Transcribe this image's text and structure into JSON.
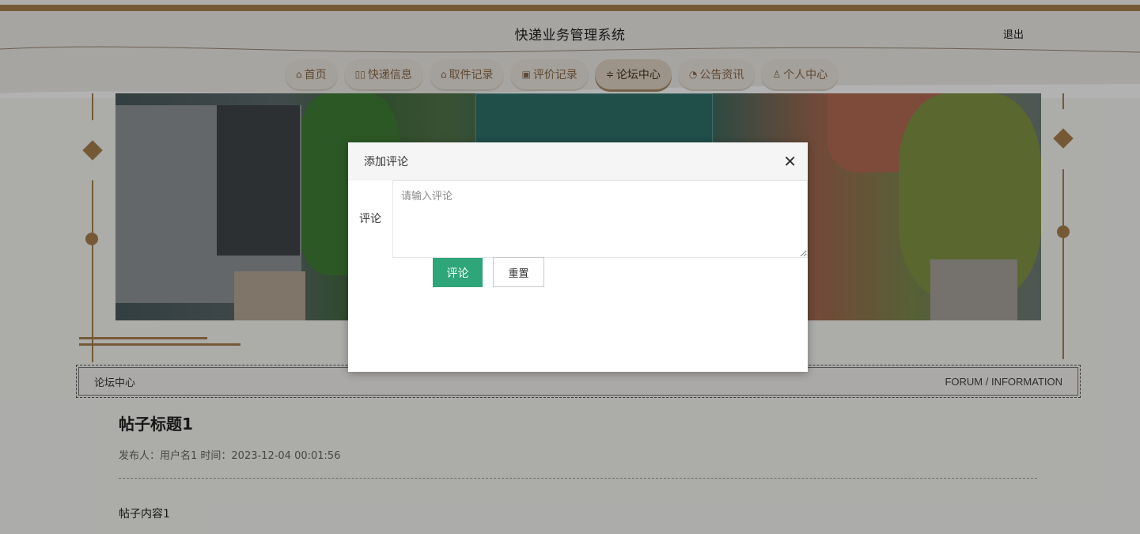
{
  "header": {
    "title": "快递业务管理系统",
    "logout_label": "退出"
  },
  "nav": {
    "items": [
      {
        "label": "首页",
        "icon": "home-icon",
        "glyph": "⌂"
      },
      {
        "label": "快递信息",
        "icon": "book-icon",
        "glyph": "▯▯"
      },
      {
        "label": "取件记录",
        "icon": "package-icon",
        "glyph": "⌂"
      },
      {
        "label": "评价记录",
        "icon": "gift-icon",
        "glyph": "▣"
      },
      {
        "label": "论坛中心",
        "icon": "sliders-icon",
        "glyph": "≑",
        "active": true
      },
      {
        "label": "公告资讯",
        "icon": "gauge-icon",
        "glyph": "◔"
      },
      {
        "label": "个人中心",
        "icon": "user-icon",
        "glyph": "♙"
      }
    ]
  },
  "section": {
    "title": "论坛中心",
    "subtitle": "FORUM / INFORMATION"
  },
  "post": {
    "title": "帖子标题1",
    "meta": "发布人：用户名1 时间：2023-12-04 00:01:56",
    "content": "帖子内容1"
  },
  "dialog": {
    "title": "添加评论",
    "field_label": "评论",
    "placeholder": "请输入评论",
    "submit_label": "评论",
    "reset_label": "重置"
  },
  "colors": {
    "accent": "#a8804e",
    "submit": "#2fa57a"
  }
}
